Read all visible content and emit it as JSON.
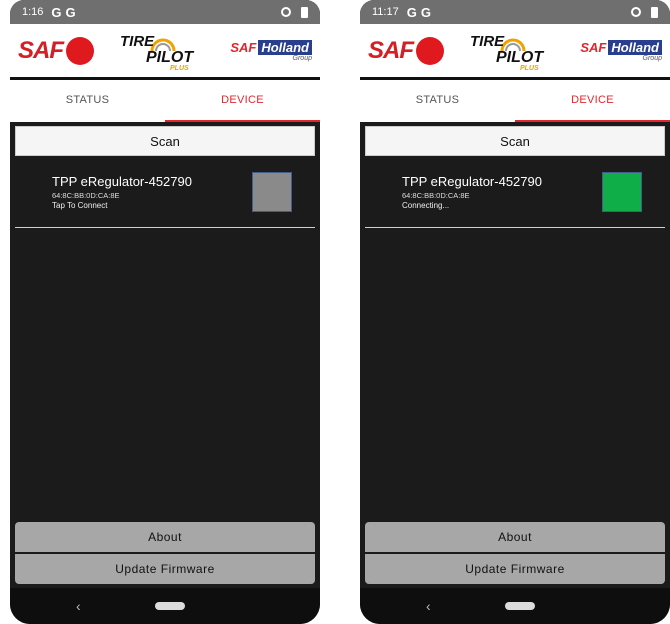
{
  "screens": [
    {
      "status": {
        "time": "1:16",
        "g1": "G",
        "g2": "G"
      },
      "header": {
        "saf": "SAF",
        "tire_1": "TIRE",
        "tire_2": "PILOT",
        "tire_3": "PLUS",
        "holland_1": "SAF",
        "holland_2": "Holland",
        "holland_3": "Group"
      },
      "tabs": [
        {
          "label": "STATUS"
        },
        {
          "label": "DEVICE"
        }
      ],
      "active_tab": "DEVICE",
      "scan_label": "Scan",
      "device": {
        "name": "TPP eRegulator-452790",
        "mac": "64:8C:BB:0D:CA:8E",
        "state": "Tap To Connect",
        "indicator_color": "#8a8a8a"
      },
      "buttons": {
        "about": "About",
        "firmware": "Update Firmware"
      },
      "nav": {
        "back": "‹"
      }
    },
    {
      "status": {
        "time": "11:17",
        "g1": "G",
        "g2": "G"
      },
      "header": {
        "saf": "SAF",
        "tire_1": "TIRE",
        "tire_2": "PILOT",
        "tire_3": "PLUS",
        "holland_1": "SAF",
        "holland_2": "Holland",
        "holland_3": "Group"
      },
      "tabs": [
        {
          "label": "STATUS"
        },
        {
          "label": "DEVICE"
        }
      ],
      "active_tab": "DEVICE",
      "scan_label": "Scan",
      "device": {
        "name": "TPP eRegulator-452790",
        "mac": "64:8C:BB:0D:CA:8E",
        "state": "Connecting...",
        "indicator_color": "#0fae49"
      },
      "buttons": {
        "about": "About",
        "firmware": "Update Firmware"
      },
      "nav": {
        "back": "‹"
      }
    }
  ],
  "colors": {
    "accent": "#e3262d",
    "saf_red": "#e0191f",
    "background": "#1b1b1b",
    "button_gray": "#a7a7a7"
  }
}
